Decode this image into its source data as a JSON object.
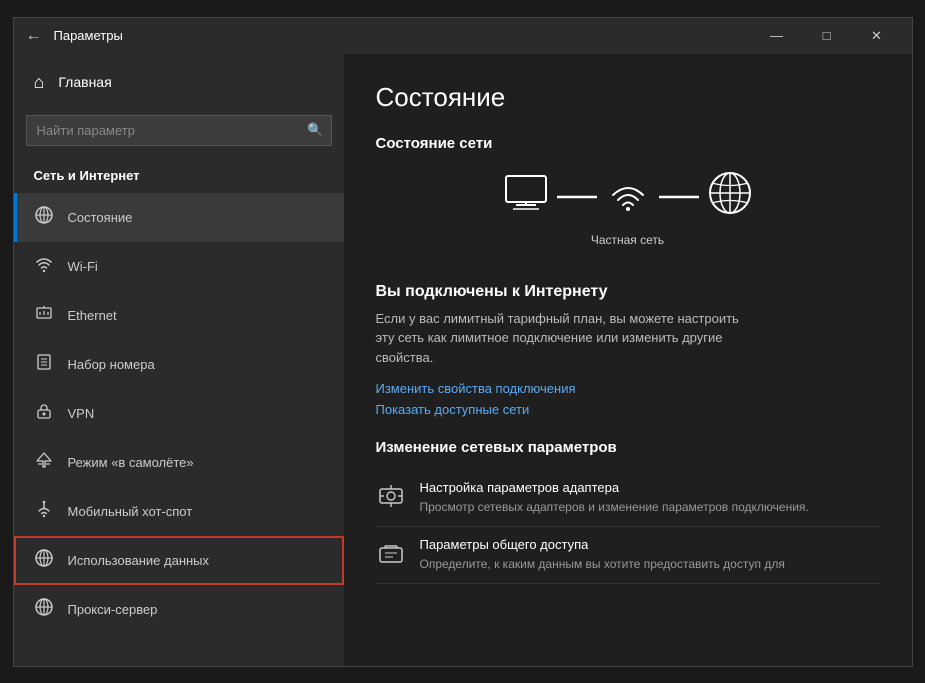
{
  "window": {
    "title": "Параметры",
    "back_icon": "←",
    "minimize_label": "—",
    "maximize_label": "□",
    "close_label": "✕"
  },
  "sidebar": {
    "home_label": "Главная",
    "search_placeholder": "Найти параметр",
    "section_title": "Сеть и Интернет",
    "items": [
      {
        "id": "status",
        "label": "Состояние",
        "icon": "🌐",
        "active": true
      },
      {
        "id": "wifi",
        "label": "Wi-Fi",
        "icon": "📶"
      },
      {
        "id": "ethernet",
        "label": "Ethernet",
        "icon": "🖥"
      },
      {
        "id": "dialup",
        "label": "Набор номера",
        "icon": "📠"
      },
      {
        "id": "vpn",
        "label": "VPN",
        "icon": "🔒"
      },
      {
        "id": "airplane",
        "label": "Режим «в самолёте»",
        "icon": "✈"
      },
      {
        "id": "hotspot",
        "label": "Мобильный хот-спот",
        "icon": "📡"
      },
      {
        "id": "datausage",
        "label": "Использование данных",
        "icon": "🌐",
        "highlighted": true
      },
      {
        "id": "proxy",
        "label": "Прокси-сервер",
        "icon": "🌐"
      }
    ]
  },
  "main": {
    "title": "Состояние",
    "network_status_section": "Состояние сети",
    "private_network_label": "Частная сеть",
    "connected_title": "Вы подключены к Интернету",
    "connected_desc": "Если у вас лимитный тарифный план, вы можете настроить эту сеть как лимитное подключение или изменить другие свойства.",
    "link1": "Изменить свойства подключения",
    "link2": "Показать доступные сети",
    "change_section_title": "Изменение сетевых параметров",
    "settings_items": [
      {
        "id": "adapter",
        "title": "Настройка параметров адаптера",
        "desc": "Просмотр сетевых адаптеров и изменение параметров подключения."
      },
      {
        "id": "sharing",
        "title": "Параметры общего доступа",
        "desc": "Определите, к каким данным вы хотите предоставить доступ для"
      }
    ]
  }
}
